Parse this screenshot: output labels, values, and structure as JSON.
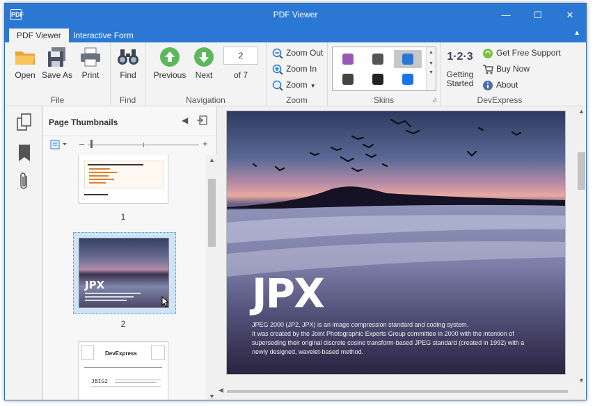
{
  "window": {
    "title": "PDF Viewer",
    "app_icon": "PDF"
  },
  "title_controls": {
    "minimize": "—",
    "maximize": "☐",
    "close": "✕"
  },
  "tabs": [
    {
      "label": "PDF Viewer",
      "active": true
    },
    {
      "label": "Interactive Form",
      "active": false
    }
  ],
  "ribbon": {
    "file": {
      "group": "File",
      "open": "Open",
      "save_as": "Save As",
      "print": "Print"
    },
    "find": {
      "group": "Find",
      "find": "Find"
    },
    "navigation": {
      "group": "Navigation",
      "previous": "Previous",
      "next": "Next",
      "page_value": "2",
      "of_text": "of 7"
    },
    "zoom": {
      "group": "Zoom",
      "zoom_out": "Zoom Out",
      "zoom_in": "Zoom In",
      "zoom": "Zoom"
    },
    "skins": {
      "group": "Skins",
      "selected_index": 2,
      "colors": [
        "#9b59b6",
        "#555555",
        "#2b78d4",
        "#444444",
        "#222222",
        "#1a73e8"
      ]
    },
    "devexpress": {
      "group": "DevExpress",
      "getting_started_icon": "1·2·3",
      "getting_started": "Getting Started",
      "get_free_support": "Get Free Support",
      "buy_now": "Buy Now",
      "about": "About"
    }
  },
  "thumbnail_panel": {
    "title": "Page Thumbnails",
    "pages": [
      {
        "label": "1",
        "selected": false
      },
      {
        "label": "2",
        "selected": true
      },
      {
        "label": "",
        "selected": false,
        "brand": "DevExpress",
        "heading": "JBIG2"
      }
    ]
  },
  "document_page": {
    "heading": "JPX",
    "lines": [
      "JPEG 2000 (JP2, JPX) is an image compression standard and coding system.",
      "It was created by the Joint Photographic Experts Group committee in 2000 with the intention of",
      "superseding their original discrete cosine transform-based JPEG standard (created in 1992) with a",
      "newly designed, wavelet-based method."
    ]
  },
  "colors": {
    "accent": "#2b78d4",
    "ribbon_bg": "#f3f3f3"
  }
}
